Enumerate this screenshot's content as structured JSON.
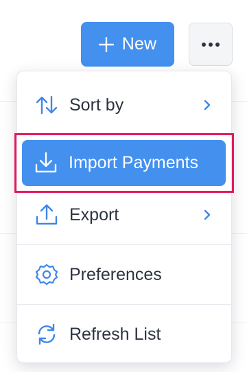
{
  "toolbar": {
    "new_label": "New",
    "new_icon": "plus-icon",
    "more_icon": "more-horizontal-icon"
  },
  "menu": {
    "items": [
      {
        "label": "Sort by",
        "icon": "sort-arrows-icon",
        "has_submenu": true
      },
      {
        "label": "Import Payments",
        "icon": "import-download-icon",
        "has_submenu": false,
        "highlighted": true
      },
      {
        "label": "Export",
        "icon": "export-upload-icon",
        "has_submenu": true
      },
      {
        "label": "Preferences",
        "icon": "gear-icon",
        "has_submenu": false
      },
      {
        "label": "Refresh List",
        "icon": "refresh-icon",
        "has_submenu": false
      }
    ]
  },
  "colors": {
    "accent": "#4390ef",
    "highlight_border": "#e5195f",
    "icon": "#3f86e8",
    "text": "#2d3340"
  }
}
